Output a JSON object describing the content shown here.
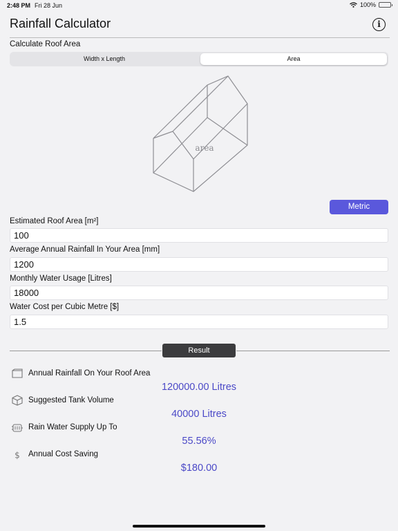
{
  "status_bar": {
    "time": "2:48 PM",
    "date": "Fri 28 Jun",
    "battery": "100%",
    "battery_level": 1.0
  },
  "header": {
    "title": "Rainfall Calculator",
    "info_icon": "info-icon"
  },
  "roof_area": {
    "section_label": "Calculate Roof Area",
    "segments": [
      {
        "label": "Width x Length",
        "selected": false
      },
      {
        "label": "Area",
        "selected": true
      }
    ],
    "diagram_label": "area"
  },
  "units_button": {
    "label": "Metric",
    "color": "#5a58dc"
  },
  "fields": [
    {
      "label": "Estimated Roof Area [m²]",
      "value": "100"
    },
    {
      "label": "Average Annual Rainfall In Your Area [mm]",
      "value": "1200"
    },
    {
      "label": "Monthly Water Usage [Litres]",
      "value": "18000"
    },
    {
      "label": "Water Cost per Cubic Metre [$]",
      "value": "1.5"
    }
  ],
  "result_button": {
    "label": "Result"
  },
  "results": [
    {
      "icon": "roof-icon",
      "label": "Annual Rainfall On Your Roof Area",
      "value": "120000.00 Litres"
    },
    {
      "icon": "tank-icon",
      "label": "Suggested Tank Volume",
      "value": "40000 Litres"
    },
    {
      "icon": "water-supply-icon",
      "label": "Rain Water Supply Up To",
      "value": "55.56%"
    },
    {
      "icon": "dollar-icon",
      "label": "Annual Cost Saving",
      "value": "$180.00"
    }
  ],
  "colors": {
    "accent": "#5a58dc",
    "result_value": "#4b49c7",
    "result_button": "#3c3c3e"
  }
}
